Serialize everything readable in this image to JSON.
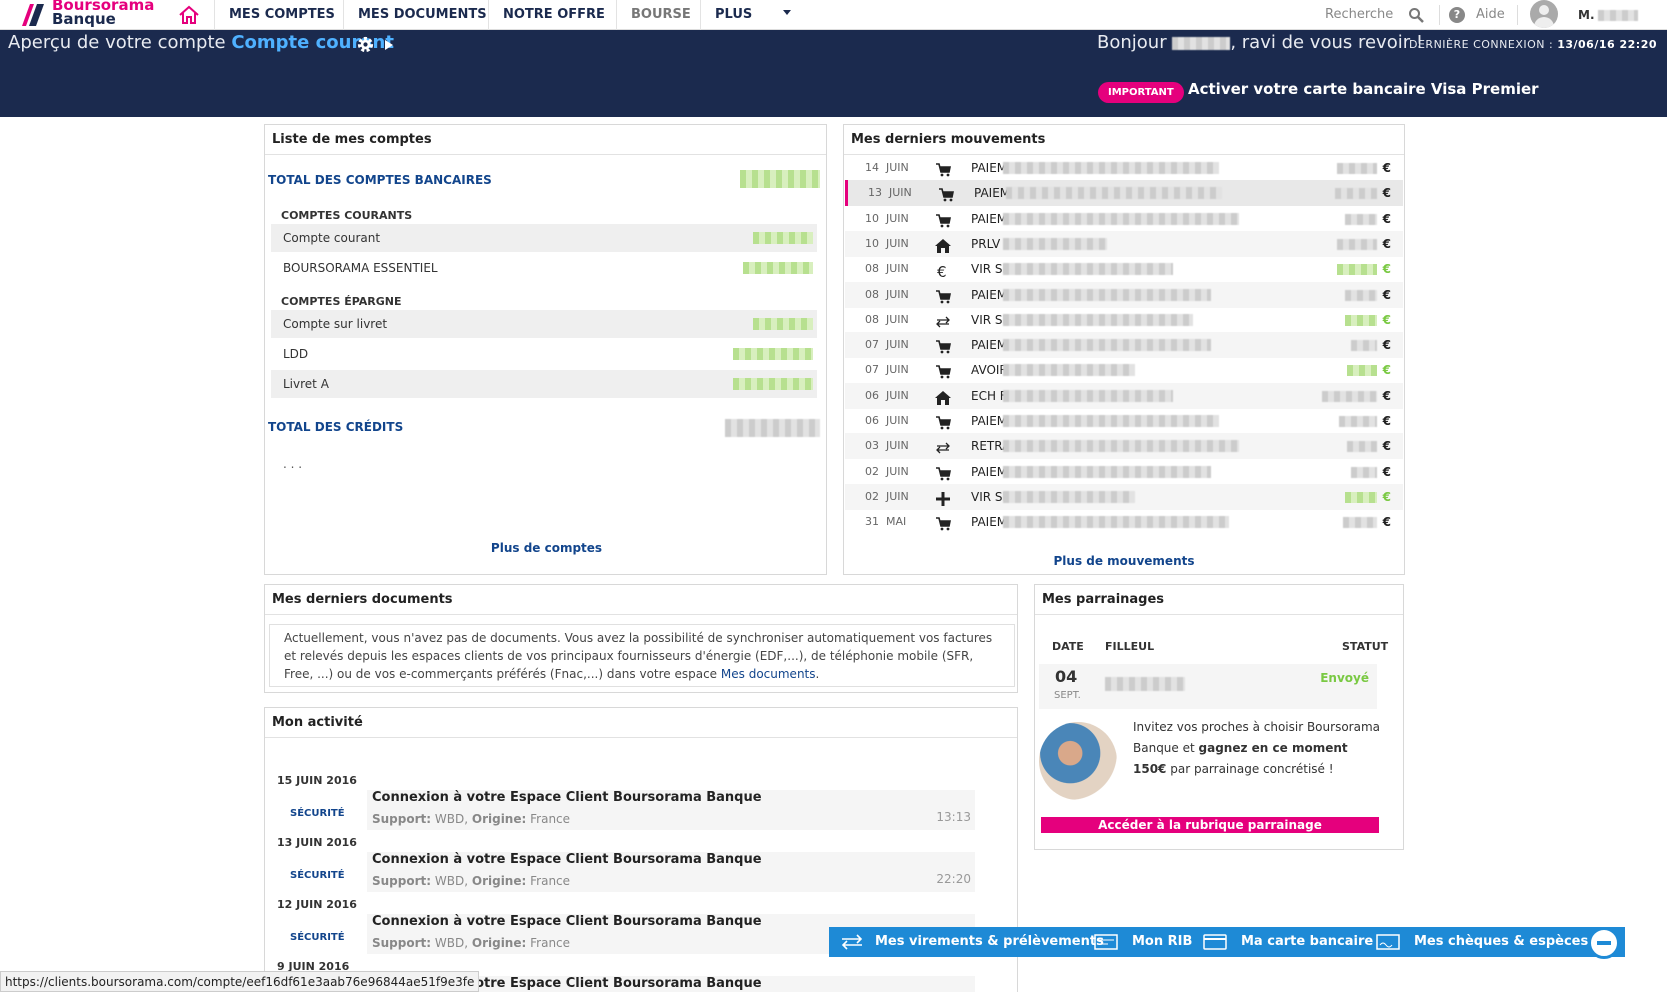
{
  "brand": {
    "line1": "Boursorama",
    "line2": "Banque",
    "accent": "#e5007d",
    "navy": "#1b2a4e"
  },
  "nav": {
    "items": [
      {
        "label": "MES COMPTES"
      },
      {
        "label": "MES DOCUMENTS"
      },
      {
        "label": "NOTRE OFFRE"
      },
      {
        "label": "BOURSE"
      },
      {
        "label": "PLUS"
      }
    ],
    "search_label": "Recherche",
    "help_label": "Aide",
    "user_initial": "M."
  },
  "header": {
    "apercu_prefix": "Aperçu de votre compte",
    "account_name": "Compte courant",
    "greeting_pre": "Bonjour",
    "greeting_post": ", ravi de vous revoir !",
    "last_login_label": "DERNIÈRE CONNEXION :",
    "last_login_value": "13/06/16 22:20",
    "important_badge": "IMPORTANT",
    "important_text": "Activer votre carte bancaire Visa Premier"
  },
  "accounts": {
    "title": "Liste de mes comptes",
    "total_bank_label": "TOTAL DES COMPTES BANCAIRES",
    "courants_label": "COMPTES COURANTS",
    "courants": [
      {
        "name": "Compte courant"
      },
      {
        "name": "BOURSORAMA ESSENTIEL"
      }
    ],
    "epargne_label": "COMPTES ÉPARGNE",
    "epargne": [
      {
        "name": "Compte sur livret"
      },
      {
        "name": "LDD"
      },
      {
        "name": "Livret A"
      }
    ],
    "total_credit_label": "TOTAL DES CRÉDITS",
    "ellipsis": ". . .",
    "more_link": "Plus de comptes"
  },
  "movements": {
    "title": "Mes derniers mouvements",
    "currency": "€",
    "rows": [
      {
        "day": "14",
        "month": "JUIN",
        "icon": "cart-icon",
        "label": "PAIEM",
        "credit": false
      },
      {
        "day": "13",
        "month": "JUIN",
        "icon": "cart-icon",
        "label": "PAIEM",
        "credit": false
      },
      {
        "day": "10",
        "month": "JUIN",
        "icon": "cart-icon",
        "label": "PAIEM",
        "credit": false
      },
      {
        "day": "10",
        "month": "JUIN",
        "icon": "home-icon",
        "label": "PRLV",
        "credit": false
      },
      {
        "day": "08",
        "month": "JUIN",
        "icon": "euro-icon",
        "label": "VIR SI",
        "credit": true
      },
      {
        "day": "08",
        "month": "JUIN",
        "icon": "cart-icon",
        "label": "PAIEM",
        "credit": false
      },
      {
        "day": "08",
        "month": "JUIN",
        "icon": "transfer-icon",
        "label": "VIR SI",
        "credit": true
      },
      {
        "day": "07",
        "month": "JUIN",
        "icon": "cart-icon",
        "label": "PAIEM",
        "credit": false
      },
      {
        "day": "07",
        "month": "JUIN",
        "icon": "cart-icon",
        "label": "AVOIR",
        "credit": true
      },
      {
        "day": "06",
        "month": "JUIN",
        "icon": "home-icon",
        "label": "ECH F",
        "credit": false
      },
      {
        "day": "06",
        "month": "JUIN",
        "icon": "cart-icon",
        "label": "PAIEM",
        "credit": false
      },
      {
        "day": "03",
        "month": "JUIN",
        "icon": "transfer-icon",
        "label": "RETRA",
        "credit": false
      },
      {
        "day": "02",
        "month": "JUIN",
        "icon": "cart-icon",
        "label": "PAIEM",
        "credit": false
      },
      {
        "day": "02",
        "month": "JUIN",
        "icon": "plus-icon",
        "label": "VIR SI",
        "credit": true
      },
      {
        "day": "31",
        "month": "MAI",
        "icon": "cart-icon",
        "label": "PAIEM",
        "credit": false
      }
    ],
    "more_link": "Plus de mouvements"
  },
  "documents": {
    "title": "Mes derniers documents",
    "text": "Actuellement, vous n'avez pas de documents. Vous avez la possibilité de synchroniser automatiquement vos factures et relevés depuis les espaces clients de vos principaux fournisseurs d'énergie (EDF,...), de téléphonie mobile (SFR, Free, ...) ou de vos e-commerçants préférés (Fnac,...) dans votre espace",
    "link": "Mes documents",
    "tail": "."
  },
  "activity": {
    "title": "Mon activité",
    "support_label": "Support:",
    "origin_label": "Origine:",
    "items": [
      {
        "date": "15 JUIN 2016",
        "tag": "SÉCURITÉ",
        "title": "Connexion à votre Espace Client Boursorama Banque",
        "support": "WBD,",
        "origin": "France",
        "time": "13:13"
      },
      {
        "date": "13 JUIN 2016",
        "tag": "SÉCURITÉ",
        "title": "Connexion à votre Espace Client Boursorama Banque",
        "support": "WBD,",
        "origin": "France",
        "time": "22:20"
      },
      {
        "date": "12 JUIN 2016",
        "tag": "SÉCURITÉ",
        "title": "Connexion à votre Espace Client Boursorama Banque",
        "support": "WBD,",
        "origin": "France",
        "time": ""
      },
      {
        "date": "9 JUIN 2016",
        "tag": "",
        "title": "Connexion à votre Espace Client Boursorama Banque",
        "support": "",
        "origin": "",
        "time": ""
      }
    ]
  },
  "referral": {
    "title": "Mes parrainages",
    "col_date": "DATE",
    "col_filleul": "FILLEUL",
    "col_statut": "STATUT",
    "row_day": "04",
    "row_month": "SEPT.",
    "row_status": "Envoyé",
    "text_pre": "Invitez vos proches à choisir Boursorama Banque et",
    "text_bold": "gagnez en ce moment 150€",
    "text_post": "par parrainage concrétisé !",
    "button": "Accéder à la rubrique parrainage"
  },
  "bottom_bar": {
    "items": [
      {
        "label": "Mes virements & prélèvements",
        "icon": "transfer-icon"
      },
      {
        "label": "Mon RIB",
        "icon": "rib-icon"
      },
      {
        "label": "Ma carte bancaire",
        "icon": "card-icon"
      },
      {
        "label": "Mes chèques & espèces",
        "icon": "cheque-icon"
      }
    ]
  },
  "status_url": "https://clients.boursorama.com/compte/eef16df61e3aab76e96844ae51f9e3fe"
}
